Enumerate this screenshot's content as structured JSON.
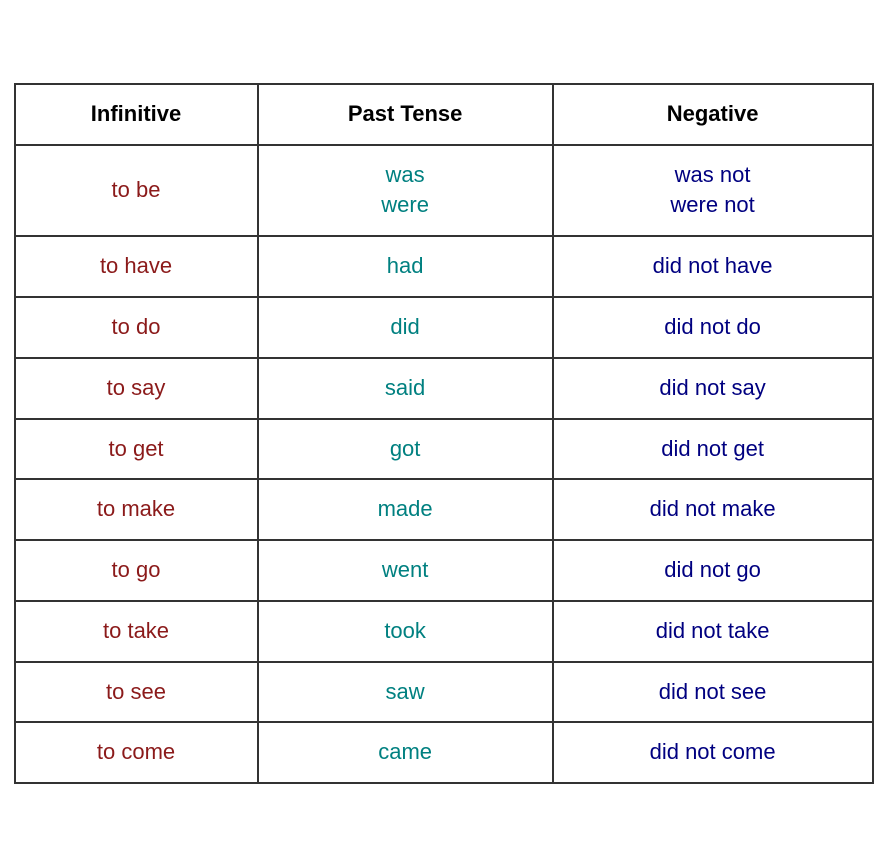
{
  "table": {
    "headers": {
      "infinitive": "Infinitive",
      "past_tense": "Past Tense",
      "negative": "Negative"
    },
    "rows": [
      {
        "infinitive": "to be",
        "past_tense": "was\nwere",
        "negative": "was not\nwere not"
      },
      {
        "infinitive": "to have",
        "past_tense": "had",
        "negative": "did not have"
      },
      {
        "infinitive": "to do",
        "past_tense": "did",
        "negative": "did not do"
      },
      {
        "infinitive": "to say",
        "past_tense": "said",
        "negative": "did not say"
      },
      {
        "infinitive": "to get",
        "past_tense": "got",
        "negative": "did not get"
      },
      {
        "infinitive": "to make",
        "past_tense": "made",
        "negative": "did not make"
      },
      {
        "infinitive": "to go",
        "past_tense": "went",
        "negative": "did not go"
      },
      {
        "infinitive": "to take",
        "past_tense": "took",
        "negative": "did not take"
      },
      {
        "infinitive": "to see",
        "past_tense": "saw",
        "negative": "did not see"
      },
      {
        "infinitive": "to come",
        "past_tense": "came",
        "negative": "did not come"
      }
    ]
  }
}
